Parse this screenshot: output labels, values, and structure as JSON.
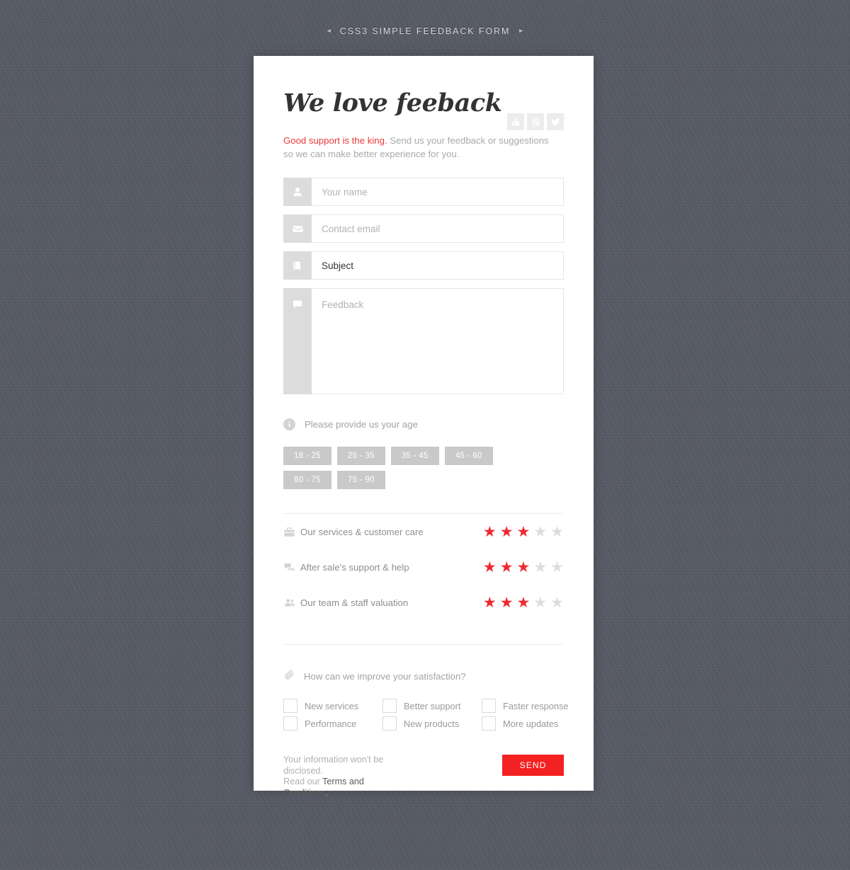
{
  "banner": {
    "left_arrow": "◄",
    "title": "CSS3 SIMPLE FEEDBACK FORM",
    "right_arrow": "►"
  },
  "social": [
    {
      "name": "thumbs-up-icon",
      "label": "Like"
    },
    {
      "name": "dribbble-icon",
      "label": "Dribbble"
    },
    {
      "name": "twitter-icon",
      "label": "Twitter"
    }
  ],
  "form": {
    "title": "We love feeback",
    "subtitle_accent": "Good support is the king.",
    "subtitle_rest": " Send us your feedback or suggestions so we can make better experience for you.",
    "fields": [
      {
        "icon": "user-icon",
        "placeholder": "Your name",
        "value": ""
      },
      {
        "icon": "envelope-icon",
        "placeholder": "Contact email",
        "value": ""
      },
      {
        "icon": "book-icon",
        "placeholder": "Subject",
        "value": "Subject"
      },
      {
        "icon": "comment-icon",
        "placeholder": "Feedback",
        "value": ""
      }
    ]
  },
  "age": {
    "icon": "info-icon",
    "icon_glyph": "i",
    "question": "Please provide us your age",
    "options": [
      "18 - 25",
      "25 - 35",
      "35 - 45",
      "45 - 60",
      "60 - 75",
      "75 - 90"
    ]
  },
  "ratings": {
    "max_stars": 5,
    "star_glyph": "★",
    "items": [
      {
        "icon": "briefcase-icon",
        "label": "Our services & customer care",
        "value": 3
      },
      {
        "icon": "comments-icon",
        "label": "After sale's support & help",
        "value": 3
      },
      {
        "icon": "users-icon",
        "label": "Our team & staff valuation",
        "value": 3
      }
    ]
  },
  "improve": {
    "icon": "paperclip-icon",
    "question": "How can we improve your satisfaction?",
    "options": [
      {
        "label": "New services",
        "checked": false
      },
      {
        "label": "Better support",
        "checked": false
      },
      {
        "label": "Faster response",
        "checked": false
      },
      {
        "label": "Performance",
        "checked": false
      },
      {
        "label": "New products",
        "checked": false
      },
      {
        "label": "More updates",
        "checked": false
      }
    ]
  },
  "footer": {
    "note_line1": "Your information won't be disclosed.",
    "note_line2_prefix": "Read our ",
    "note_link": "Terms and Conditions",
    "note_line2_suffix": ".",
    "send_label": "SEND"
  },
  "colors": {
    "background": "#565a64",
    "card": "#ffffff",
    "accent_red": "#e8393c",
    "star_on": "#ef2b2f",
    "star_off": "#dddddd",
    "send_button": "#f32122",
    "age_button": "#c9c9c9",
    "field_icon_bg": "#dcdcdc"
  }
}
